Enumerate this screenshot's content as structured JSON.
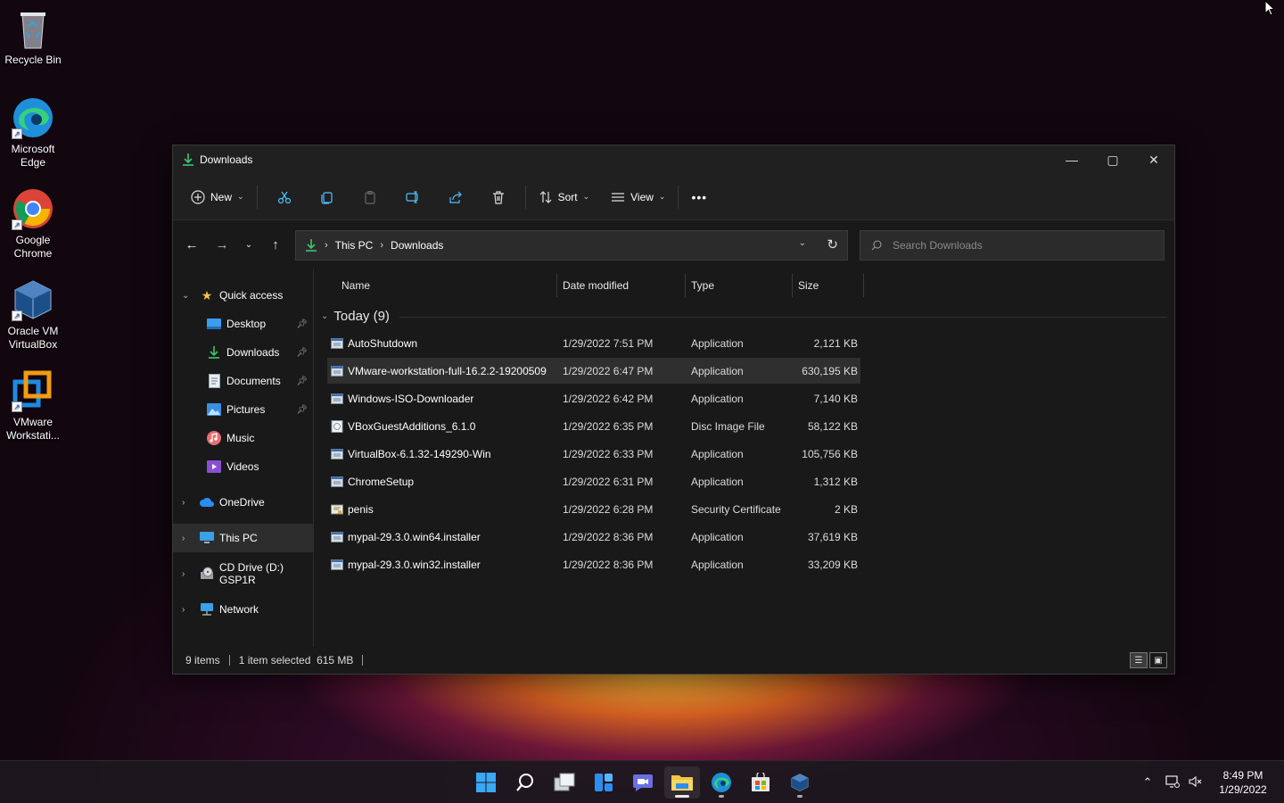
{
  "desktop": {
    "icons": [
      {
        "label": "Recycle Bin"
      },
      {
        "label": "Microsoft Edge"
      },
      {
        "label": "Google Chrome"
      },
      {
        "label": "Oracle VM VirtualBox"
      },
      {
        "label": "VMware Workstati..."
      }
    ]
  },
  "window": {
    "title": "Downloads",
    "controls": {
      "minimize": "—",
      "maximize": "▢",
      "close": "✕"
    }
  },
  "commandbar": {
    "new_label": "New",
    "sort_label": "Sort",
    "view_label": "View",
    "more_label": "•••"
  },
  "addressbar": {
    "crumbs": [
      "This PC",
      "Downloads"
    ]
  },
  "search": {
    "placeholder": "Search Downloads"
  },
  "navpane": {
    "quick_access": "Quick access",
    "items": [
      {
        "label": "Desktop"
      },
      {
        "label": "Downloads"
      },
      {
        "label": "Documents"
      },
      {
        "label": "Pictures"
      },
      {
        "label": "Music"
      },
      {
        "label": "Videos"
      }
    ],
    "onedrive": "OneDrive",
    "this_pc": "This PC",
    "cd_drive": "CD Drive (D:) GSP1R",
    "network": "Network"
  },
  "columns": {
    "name": "Name",
    "date": "Date modified",
    "type": "Type",
    "size": "Size"
  },
  "group": {
    "label": "Today (9)"
  },
  "files": [
    {
      "name": "AutoShutdown",
      "date": "1/29/2022 7:51 PM",
      "type": "Application",
      "size": "2,121 KB"
    },
    {
      "name": "VMware-workstation-full-16.2.2-19200509",
      "date": "1/29/2022 6:47 PM",
      "type": "Application",
      "size": "630,195 KB"
    },
    {
      "name": "Windows-ISO-Downloader",
      "date": "1/29/2022 6:42 PM",
      "type": "Application",
      "size": "7,140 KB"
    },
    {
      "name": "VBoxGuestAdditions_6.1.0",
      "date": "1/29/2022 6:35 PM",
      "type": "Disc Image File",
      "size": "58,122 KB"
    },
    {
      "name": "VirtualBox-6.1.32-149290-Win",
      "date": "1/29/2022 6:33 PM",
      "type": "Application",
      "size": "105,756 KB"
    },
    {
      "name": "ChromeSetup",
      "date": "1/29/2022 6:31 PM",
      "type": "Application",
      "size": "1,312 KB"
    },
    {
      "name": "penis",
      "date": "1/29/2022 6:28 PM",
      "type": "Security Certificate",
      "size": "2 KB"
    },
    {
      "name": "mypal-29.3.0.win64.installer",
      "date": "1/29/2022 8:36 PM",
      "type": "Application",
      "size": "37,619 KB"
    },
    {
      "name": "mypal-29.3.0.win32.installer",
      "date": "1/29/2022 8:36 PM",
      "type": "Application",
      "size": "33,209 KB"
    }
  ],
  "status": {
    "items": "9 items",
    "selected": "1 item selected  615 MB"
  },
  "taskbar": {
    "time": "8:49 PM",
    "date": "1/29/2022"
  },
  "colors": {
    "accent": "#4cc2ff",
    "folder_yellow": "#f4c542",
    "window_bg": "#191919"
  }
}
